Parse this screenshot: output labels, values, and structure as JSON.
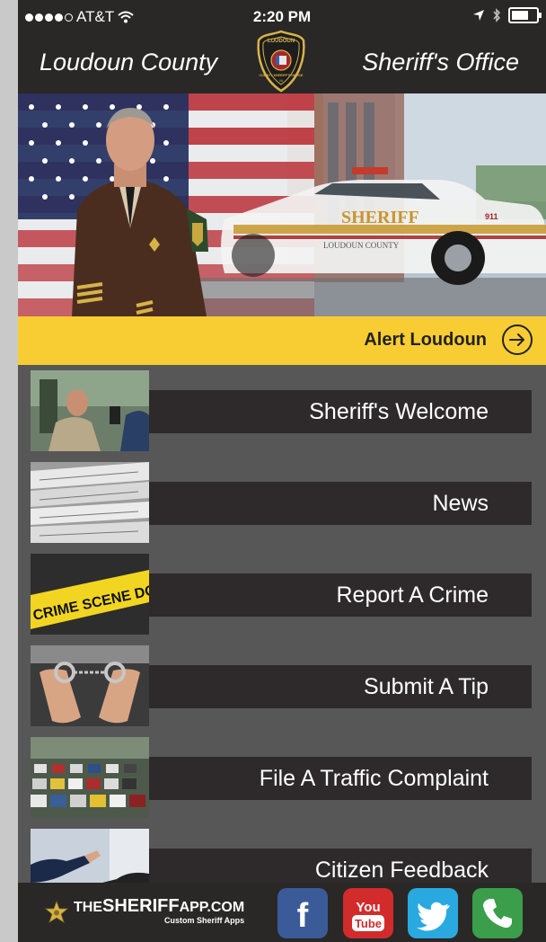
{
  "status_bar": {
    "carrier": "AT&T",
    "time": "2:20 PM"
  },
  "header": {
    "left_title": "Loudoun County",
    "right_title": "Sheriff's Office",
    "badge_text": [
      "LOUDOUN",
      "COUNTY SHERIFF'S OFFICE",
      "VA"
    ]
  },
  "hero": {
    "car_text": "SHERIFF",
    "car_subtext": "LOUDOUN COUNTY",
    "car_number": "911"
  },
  "alert": {
    "label": "Alert Loudoun"
  },
  "menu": {
    "items": [
      {
        "label": "Sheriff's Welcome"
      },
      {
        "label": "News"
      },
      {
        "label": "Report A Crime",
        "image_text": "CRIME SCENE DO NOT CROSS"
      },
      {
        "label": "Submit A Tip"
      },
      {
        "label": "File A Traffic Complaint"
      },
      {
        "label": "Citizen Feedback"
      }
    ]
  },
  "footer": {
    "brand_prefix": "THE",
    "brand_name": "SHERIFF",
    "brand_suffix": "APP.COM",
    "brand_tagline": "Custom Sheriff Apps",
    "social": [
      {
        "name": "facebook",
        "glyph": "f",
        "color": "#3b5a98"
      },
      {
        "name": "youtube",
        "glyph_top": "You",
        "glyph_bottom": "Tube",
        "color": "#d32b2b"
      },
      {
        "name": "twitter",
        "color": "#2aa9e0"
      },
      {
        "name": "phone",
        "color": "#3a9e4a"
      }
    ]
  },
  "colors": {
    "bar": "#2a2727",
    "alert": "#f8cd33",
    "menu_bg": "#575757"
  }
}
